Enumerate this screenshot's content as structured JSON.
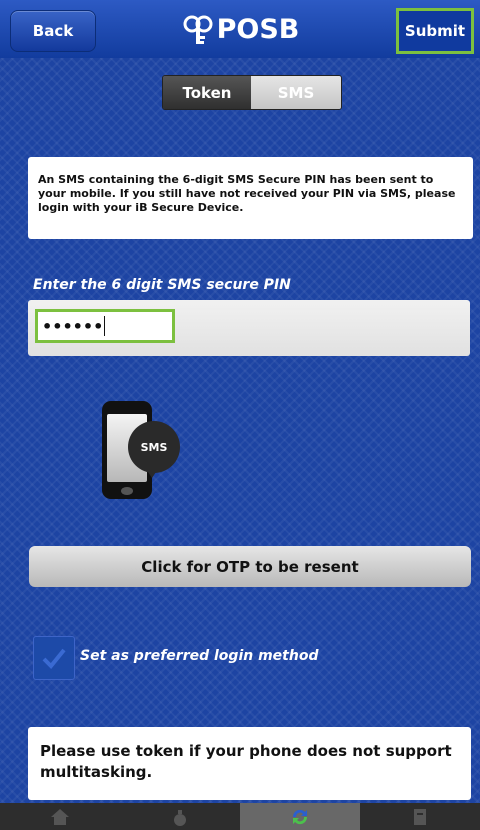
{
  "header": {
    "back_label": "Back",
    "brand": "POSB",
    "submit_label": "Submit"
  },
  "toggle": {
    "token_label": "Token",
    "sms_label": "SMS",
    "selected": "SMS"
  },
  "info_text": "An SMS containing the 6-digit SMS Secure PIN has been sent to your mobile. If you still have not received your PIN via SMS, please login with your iB Secure Device.",
  "pin": {
    "label": "Enter the 6 digit SMS secure PIN",
    "value": "••••••"
  },
  "illustration": {
    "bubble_text": "SMS"
  },
  "resend_label": "Click for OTP to be resent",
  "preferred_login": {
    "label": "Set as preferred login method",
    "checked": true
  },
  "note": "Please use token if your phone does not support multitasking.",
  "tabbar": {
    "items": [
      "home-icon",
      "money-bag-icon",
      "transfer-icon",
      "bill-icon"
    ],
    "active_index": 2
  },
  "colors": {
    "accent": "#7cc03f",
    "background": "#1d44a3"
  }
}
